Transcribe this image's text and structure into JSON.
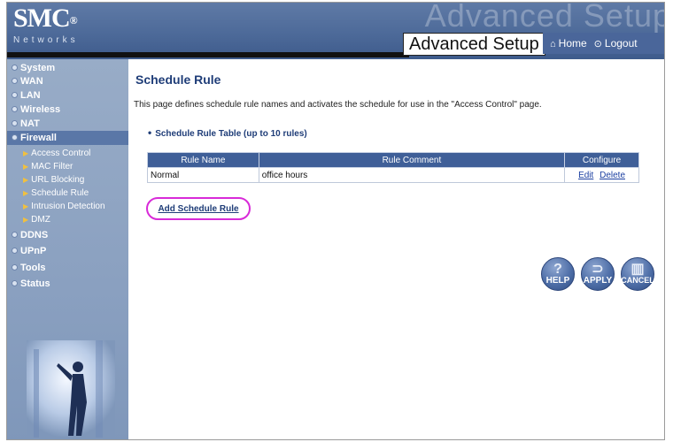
{
  "header": {
    "logo_brand": "SMC",
    "logo_reg": "®",
    "logo_sub": "Networks",
    "watermark": "Advanced Setup",
    "title": "Advanced Setup",
    "home_label": "Home",
    "logout_label": "Logout",
    "colors": {
      "bar": "#4d6a99",
      "accent": "#1f3d78"
    }
  },
  "sidebar": {
    "items": [
      {
        "label": "System"
      },
      {
        "label": "WAN"
      },
      {
        "label": "LAN"
      },
      {
        "label": "Wireless"
      },
      {
        "label": "NAT"
      },
      {
        "label": "Firewall",
        "active": true
      },
      {
        "label": "DDNS"
      },
      {
        "label": "UPnP"
      },
      {
        "label": "Tools"
      },
      {
        "label": "Status"
      }
    ],
    "firewall_subitems": [
      {
        "label": "Access Control"
      },
      {
        "label": "MAC Filter"
      },
      {
        "label": "URL Blocking"
      },
      {
        "label": "Schedule Rule"
      },
      {
        "label": "Intrusion Detection"
      },
      {
        "label": "DMZ"
      }
    ]
  },
  "main": {
    "title": "Schedule Rule",
    "description": "This page defines schedule rule names and activates the schedule for use in the \"Access Control\" page.",
    "table_heading": "Schedule Rule Table (up to 10 rules)",
    "table": {
      "columns": [
        "Rule Name",
        "Rule Comment",
        "Configure"
      ],
      "rows": [
        {
          "name": "Normal",
          "comment": "office hours",
          "edit": "Edit",
          "delete": "Delete"
        }
      ]
    },
    "add_rule_label": "Add Schedule Rule",
    "buttons": {
      "help": "HELP",
      "apply": "APPLY",
      "cancel": "CANCEL"
    }
  }
}
